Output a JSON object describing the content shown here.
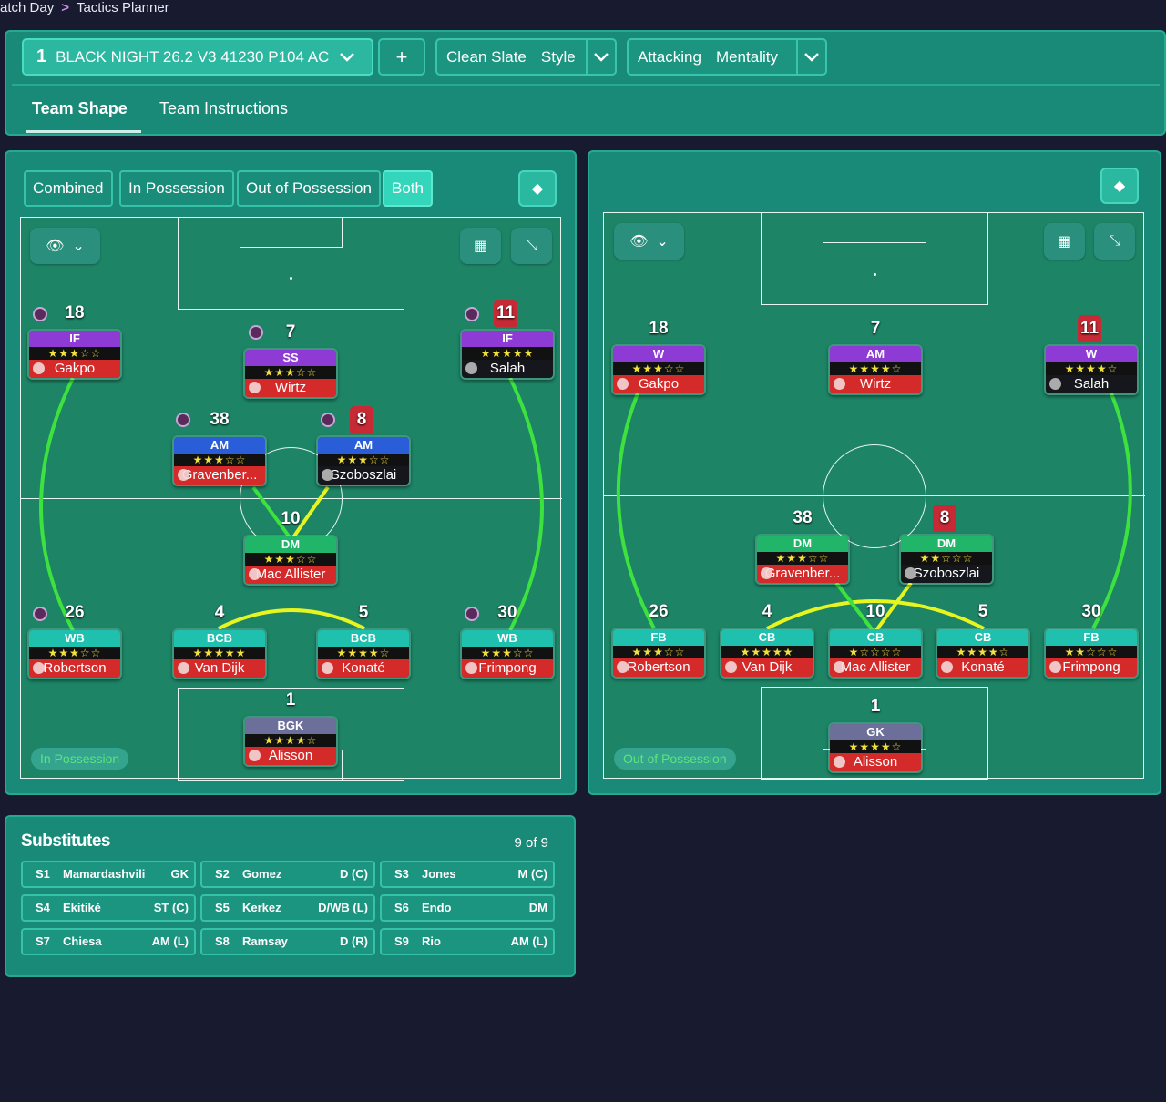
{
  "breadcrumb": {
    "root": "atch Day",
    "current": "Tactics Planner"
  },
  "tactic": {
    "number": "1",
    "name": "BLACK NIGHT 26.2 V3 41230 P104 AC"
  },
  "style": {
    "value": "Clean Slate",
    "label": "Style"
  },
  "mentality": {
    "value": "Attacking",
    "label": "Mentality"
  },
  "tabs": [
    "Team Shape",
    "Team Instructions"
  ],
  "filters": [
    "Combined",
    "In Possession",
    "Out of Possession",
    "Both"
  ],
  "left_pitch": {
    "tag": "In Possession",
    "players": [
      {
        "num": "18",
        "role": "IF",
        "stars": "★★★☆☆",
        "name": "Gakpo",
        "color": "purple"
      },
      {
        "num": "7",
        "role": "SS",
        "stars": "★★★☆☆",
        "name": "Wirtz",
        "color": "purple"
      },
      {
        "num": "11",
        "role": "IF",
        "stars": "★★★★★",
        "name": "Salah",
        "color": "purple"
      },
      {
        "num": "38",
        "role": "AM",
        "stars": "★★★☆☆",
        "name": "Gravenber...",
        "color": "blue"
      },
      {
        "num": "8",
        "role": "AM",
        "stars": "★★★☆☆",
        "name": "Szoboszlai",
        "color": "blue"
      },
      {
        "num": "10",
        "role": "DM",
        "stars": "★★★☆☆",
        "name": "Mac Allister",
        "color": "green"
      },
      {
        "num": "26",
        "role": "WB",
        "stars": "★★★☆☆",
        "name": "Robertson",
        "color": "teal"
      },
      {
        "num": "4",
        "role": "BCB",
        "stars": "★★★★★",
        "name": "Van Dijk",
        "color": "teal"
      },
      {
        "num": "5",
        "role": "BCB",
        "stars": "★★★★☆",
        "name": "Konaté",
        "color": "teal"
      },
      {
        "num": "30",
        "role": "WB",
        "stars": "★★★☆☆",
        "name": "Frimpong",
        "color": "teal"
      },
      {
        "num": "1",
        "role": "BGK",
        "stars": "★★★★☆",
        "name": "Alisson",
        "color": "gray"
      }
    ]
  },
  "right_pitch": {
    "tag": "Out of Possession",
    "players": [
      {
        "num": "18",
        "role": "W",
        "stars": "★★★☆☆",
        "name": "Gakpo",
        "color": "purple"
      },
      {
        "num": "7",
        "role": "AM",
        "stars": "★★★★☆",
        "name": "Wirtz",
        "color": "purple"
      },
      {
        "num": "11",
        "role": "W",
        "stars": "★★★★☆",
        "name": "Salah",
        "color": "purple"
      },
      {
        "num": "38",
        "role": "DM",
        "stars": "★★★☆☆",
        "name": "Gravenber...",
        "color": "green"
      },
      {
        "num": "8",
        "role": "DM",
        "stars": "★★☆☆☆",
        "name": "Szoboszlai",
        "color": "green"
      },
      {
        "num": "26",
        "role": "FB",
        "stars": "★★★☆☆",
        "name": "Robertson",
        "color": "teal"
      },
      {
        "num": "4",
        "role": "CB",
        "stars": "★★★★★",
        "name": "Van Dijk",
        "color": "teal"
      },
      {
        "num": "10",
        "role": "CB",
        "stars": "★☆☆☆☆",
        "name": "Mac Allister",
        "color": "teal"
      },
      {
        "num": "5",
        "role": "CB",
        "stars": "★★★★☆",
        "name": "Konaté",
        "color": "teal"
      },
      {
        "num": "30",
        "role": "FB",
        "stars": "★★☆☆☆",
        "name": "Frimpong",
        "color": "teal"
      },
      {
        "num": "1",
        "role": "GK",
        "stars": "★★★★☆",
        "name": "Alisson",
        "color": "gray"
      }
    ]
  },
  "substitutes": {
    "title": "Substitutes",
    "count": "9 of 9",
    "items": [
      {
        "id": "S1",
        "name": "Mamardashvili",
        "pos": "GK"
      },
      {
        "id": "S2",
        "name": "Gomez",
        "pos": "D (C)"
      },
      {
        "id": "S3",
        "name": "Jones",
        "pos": "M (C)"
      },
      {
        "id": "S4",
        "name": "Ekitiké",
        "pos": "ST (C)"
      },
      {
        "id": "S5",
        "name": "Kerkez",
        "pos": "D/WB (L)"
      },
      {
        "id": "S6",
        "name": "Endo",
        "pos": "DM"
      },
      {
        "id": "S7",
        "name": "Chiesa",
        "pos": "AM (L)"
      },
      {
        "id": "S8",
        "name": "Ramsay",
        "pos": "D (R)"
      },
      {
        "id": "S9",
        "name": "Rio",
        "pos": "AM (L)"
      }
    ]
  }
}
